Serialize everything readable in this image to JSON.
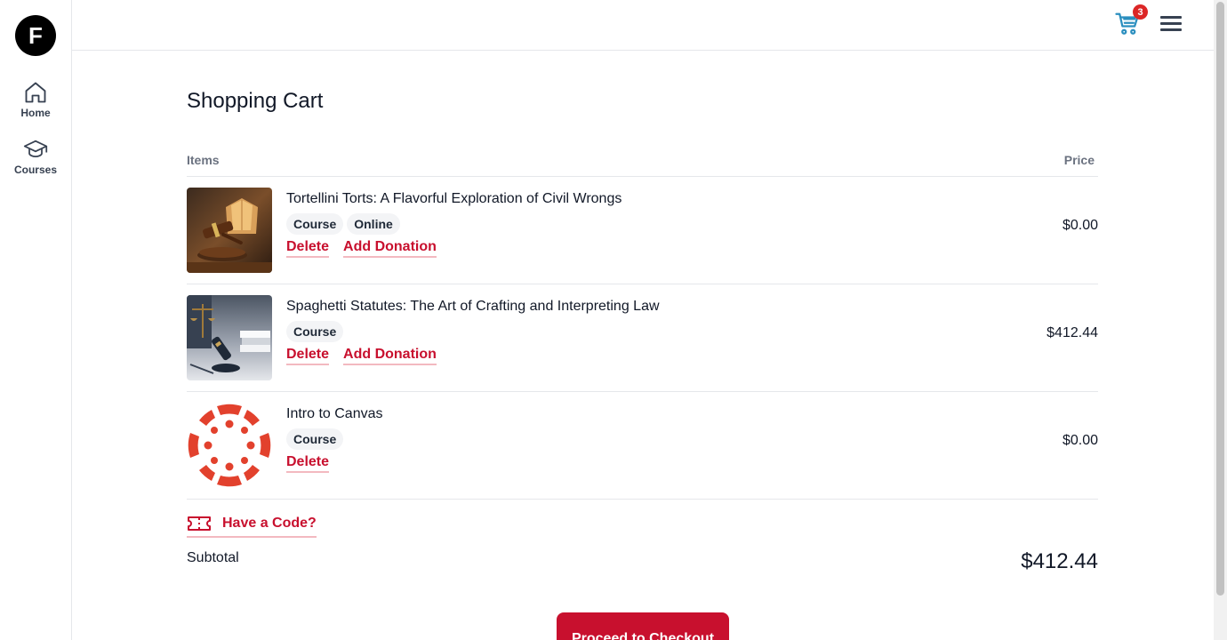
{
  "brand": {
    "logo_letter": "F"
  },
  "sidebar": {
    "items": [
      {
        "label": "Home",
        "icon": "home-icon"
      },
      {
        "label": "Courses",
        "icon": "graduation-cap-icon"
      }
    ]
  },
  "header": {
    "cart_count": "3",
    "cart_icon": "cart-icon",
    "menu_icon": "hamburger-menu-icon"
  },
  "cart": {
    "title": "Shopping Cart",
    "columns": {
      "items": "Items",
      "price": "Price"
    },
    "items": [
      {
        "title": "Tortellini Torts: A Flavorful Exploration of Civil Wrongs",
        "tags": [
          "Course",
          "Online"
        ],
        "actions": [
          "Delete",
          "Add Donation"
        ],
        "price": "$0.00",
        "image": "gavel-and-books-photo"
      },
      {
        "title": "Spaghetti Statutes: The Art of Crafting and Interpreting Law",
        "tags": [
          "Course"
        ],
        "actions": [
          "Delete",
          "Add Donation"
        ],
        "price": "$412.44",
        "image": "gavel-and-scales-photo"
      },
      {
        "title": "Intro to Canvas",
        "tags": [
          "Course"
        ],
        "actions": [
          "Delete"
        ],
        "price": "$0.00",
        "image": "canvas-logo"
      }
    ],
    "code_link": "Have a Code?",
    "subtotal_label": "Subtotal",
    "subtotal_value": "$412.44",
    "checkout_label": "Proceed to Checkout"
  },
  "colors": {
    "accent": "#c8102e",
    "cart_icon": "#2b8fbf",
    "badge": "#dc2626",
    "canvas_red": "#e2412d"
  }
}
